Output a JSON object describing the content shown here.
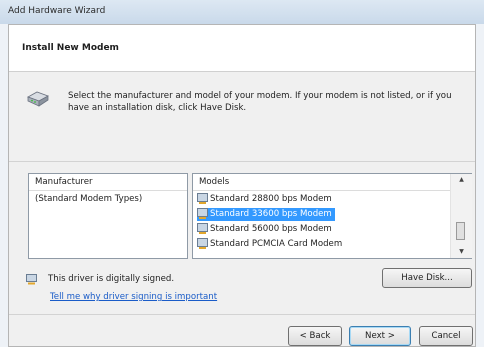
{
  "window": {
    "title": "Add Hardware Wizard"
  },
  "header": {
    "title": "Install New Modem"
  },
  "instruction": "Select the manufacturer and model of your modem. If your modem is not listed, or if you have an installation disk, click Have Disk.",
  "manufacturer": {
    "column_header": "Manufacturer",
    "items": [
      "(Standard Modem Types)"
    ]
  },
  "models": {
    "column_header": "Models",
    "items": [
      "Standard 28800 bps Modem",
      "Standard 33600 bps Modem",
      "Standard 56000 bps Modem",
      "Standard PCMCIA Card Modem"
    ],
    "selected": "Standard 33600 bps Modem"
  },
  "signing": {
    "status_text": "This driver is digitally signed.",
    "link_text": "Tell me why driver signing is important"
  },
  "buttons": {
    "have_disk": "Have Disk...",
    "back": "< Back",
    "next": "Next >",
    "cancel": "Cancel"
  },
  "colors": {
    "selection": "#3399ff",
    "link": "#1a5cc8"
  },
  "icons": [
    "modem-icon",
    "model-icon",
    "signed-driver-icon",
    "scroll-up-icon",
    "scroll-down-icon"
  ]
}
